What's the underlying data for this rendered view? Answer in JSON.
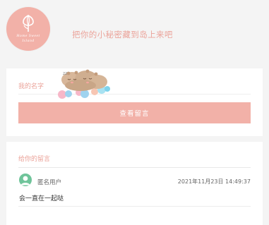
{
  "logo": {
    "line1": "Home Sweet",
    "line2": "Island"
  },
  "header": {
    "tagline": "把你的小秘密藏到岛上来吧"
  },
  "form": {
    "name_label": "我的名字",
    "mascot_text": "zz",
    "view_button_label": "查看留言"
  },
  "messages": {
    "section_title": "给你的留言",
    "items": [
      {
        "username": "匿名用户",
        "timestamp": "2021年11月23日 14:49:37",
        "text": "会一直在一起哒"
      }
    ]
  },
  "colors": {
    "accent": "#f2b1a8",
    "accent_text": "#eba39a",
    "avatar": "#6fc49a"
  }
}
